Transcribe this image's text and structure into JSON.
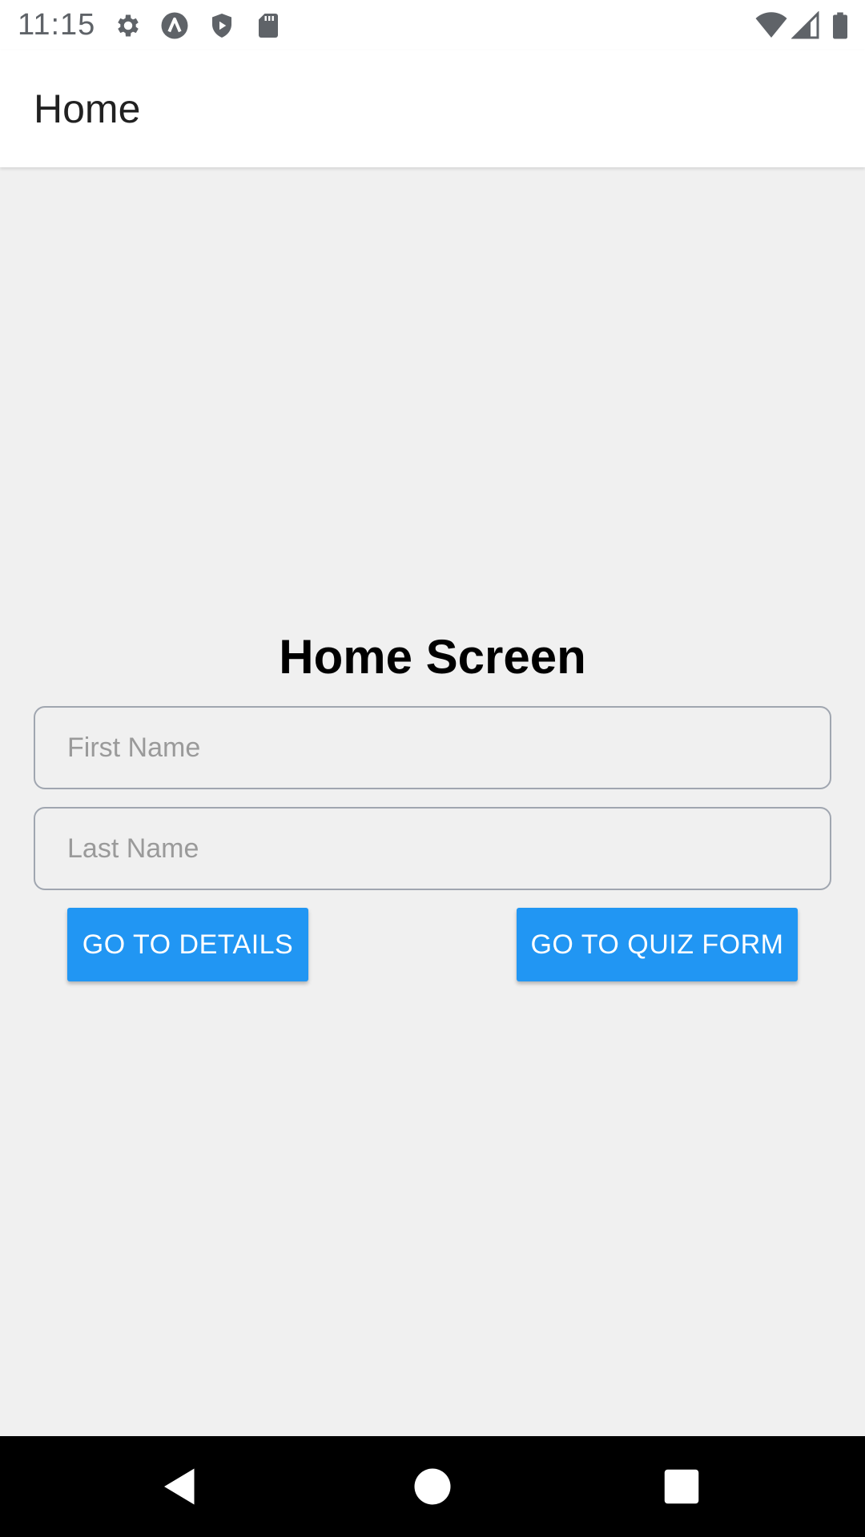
{
  "status_bar": {
    "time": "11:15",
    "left_icons": [
      "settings-icon",
      "app-a-icon",
      "shield-play-icon",
      "sd-card-icon"
    ],
    "right_icons": [
      "wifi-icon",
      "cell-signal-icon",
      "battery-icon"
    ]
  },
  "app_bar": {
    "title": "Home"
  },
  "main": {
    "heading": "Home Screen",
    "first_name_field": {
      "placeholder": "First Name",
      "value": ""
    },
    "last_name_field": {
      "placeholder": "Last Name",
      "value": ""
    },
    "details_button_label": "GO TO DETAILS",
    "quiz_button_label": "GO TO QUIZ FORM"
  },
  "nav_bar": {
    "buttons": [
      "back-icon",
      "home-icon",
      "recents-icon"
    ]
  },
  "colors": {
    "accent": "#2196f3",
    "background": "#f0f0f0",
    "app_bar": "#ffffff",
    "nav_bar": "#000000"
  }
}
